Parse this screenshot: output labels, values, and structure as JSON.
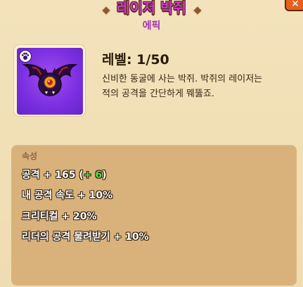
{
  "header": {
    "title": "레이저 박쥐",
    "rarity": "에픽",
    "close_label": "✕"
  },
  "colors": {
    "title": "#c43bcd",
    "rarity": "#a531b5",
    "card_bg": "#7a2ee0",
    "bonus": "#52e64b"
  },
  "pet": {
    "icon": "bat-icon",
    "badge_icon": "paw-icon",
    "level_label": "레벨: 1/50",
    "description_line1": "신비한 동굴에 사는 박쥐. 박쥐의 레이저는",
    "description_line2": "적의 공격을 간단하게 뭬뚫죠."
  },
  "stats": {
    "header": "속성",
    "attack_prefix": "공격 + 165 (",
    "attack_bonus": "+ 6",
    "attack_suffix": ")",
    "items": [
      "내 공격 속도 + 10%",
      "크리티컬 + 20%",
      "리더의 공격 물려받기 + 10%"
    ]
  }
}
